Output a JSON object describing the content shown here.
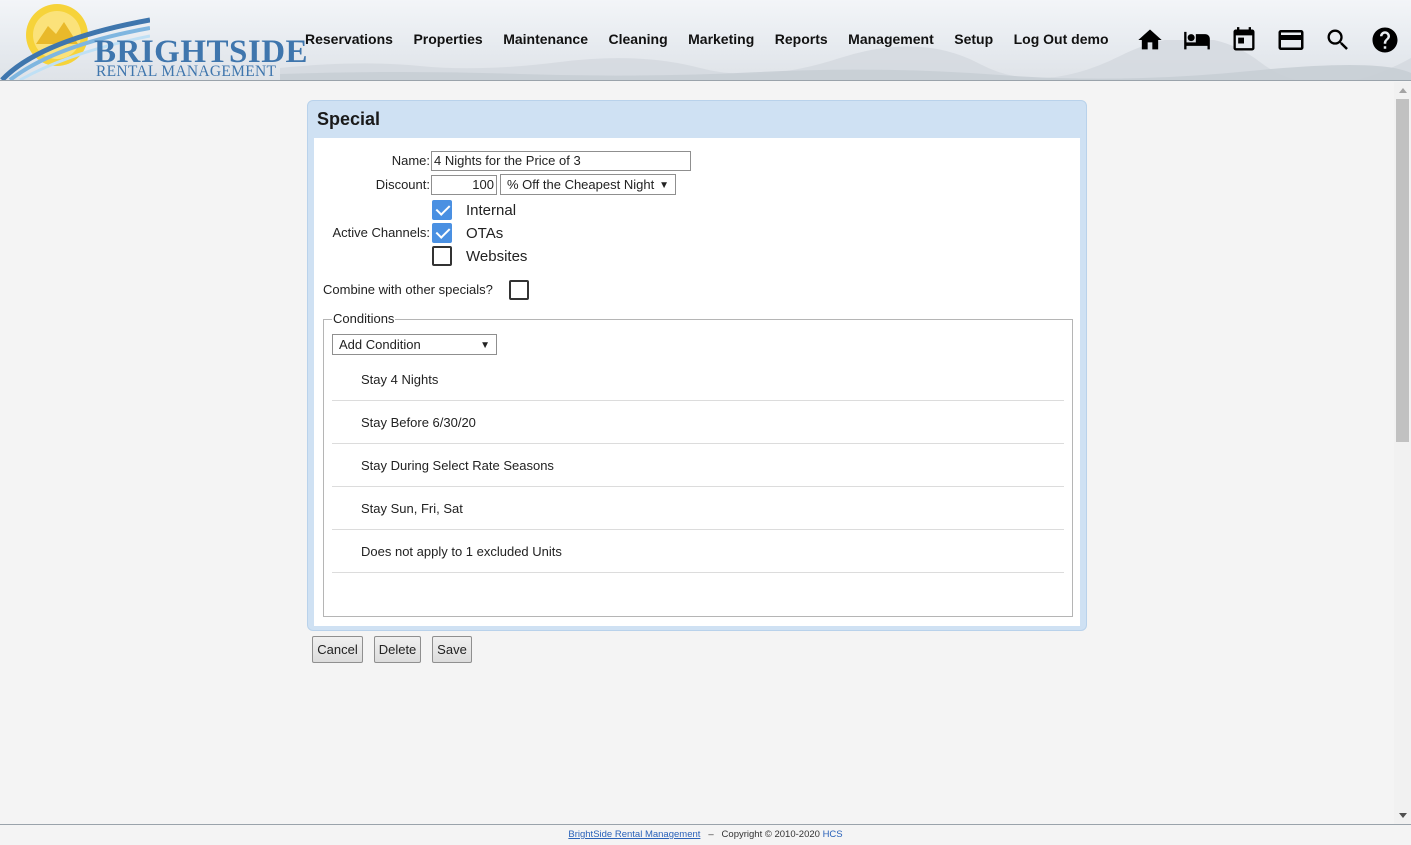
{
  "header": {
    "logo_title": "BRIGHTSIDE",
    "logo_subtitle": "RENTAL MANAGEMENT",
    "nav": [
      "Reservations",
      "Properties",
      "Maintenance",
      "Cleaning",
      "Marketing",
      "Reports",
      "Management",
      "Setup",
      "Log Out demo"
    ],
    "icons": [
      "home-icon",
      "bed-icon",
      "calendar-icon",
      "credit-card-icon",
      "search-icon",
      "help-icon"
    ]
  },
  "special": {
    "title": "Special",
    "name_label": "Name:",
    "name_value": "4 Nights for the Price of 3",
    "discount_label": "Discount:",
    "discount_value": "100",
    "discount_type": "% Off the Cheapest Night",
    "channels_label": "Active Channels:",
    "channels": [
      {
        "label": "Internal",
        "checked": true
      },
      {
        "label": "OTAs",
        "checked": true
      },
      {
        "label": "Websites",
        "checked": false
      }
    ],
    "combine_label": "Combine with other specials?",
    "combine_checked": false,
    "conditions_legend": "Conditions",
    "add_condition": "Add Condition",
    "conditions": [
      "Stay 4 Nights",
      "Stay Before 6/30/20",
      "Stay During Select Rate Seasons",
      "Stay Sun, Fri, Sat",
      "Does not apply to 1 excluded Units"
    ]
  },
  "buttons": {
    "cancel": "Cancel",
    "delete": "Delete",
    "save": "Save"
  },
  "footer": {
    "company_link": "BrightSide Rental Management",
    "separator": "–",
    "copyright": "Copyright © 2010-2020",
    "hcs": "HCS"
  },
  "colors": {
    "accent": "#3f76ad",
    "checkbox": "#4a90e2",
    "panel": "#cfe1f3"
  }
}
